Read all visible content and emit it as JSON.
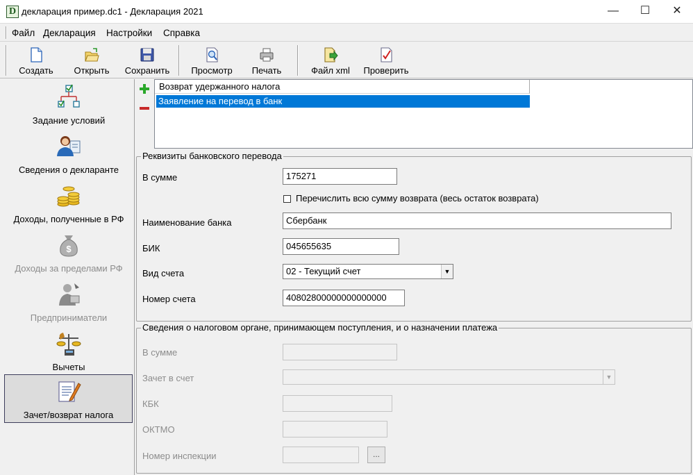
{
  "window": {
    "title": "декларация пример.dc1 - Декларация 2021",
    "app_icon_letter": "D",
    "minimize": "—",
    "maximize": "☐",
    "close": "✕"
  },
  "menu": [
    "Файл",
    "Декларация",
    "Настройки",
    "Справка"
  ],
  "toolbar": {
    "create": "Создать",
    "open": "Открыть",
    "save": "Сохранить",
    "preview": "Просмотр",
    "print": "Печать",
    "xml": "Файл xml",
    "check": "Проверить"
  },
  "sidebar": [
    {
      "label": "Задание условий",
      "icon": "flowchart-icon",
      "enabled": true
    },
    {
      "label": "Сведения о декларанте",
      "icon": "person-icon",
      "enabled": true
    },
    {
      "label": "Доходы, полученные в РФ",
      "icon": "coins-icon",
      "enabled": true
    },
    {
      "label": "Доходы за пределами РФ",
      "icon": "money-bag-icon",
      "enabled": false
    },
    {
      "label": "Предприниматели",
      "icon": "businessman-icon",
      "enabled": false
    },
    {
      "label": "Вычеты",
      "icon": "scales-icon",
      "enabled": true
    },
    {
      "label": "Зачет/возврат налога",
      "icon": "document-edit-icon",
      "enabled": true,
      "active": true
    }
  ],
  "list": {
    "header": "Возврат удержанного налога",
    "rows": [
      "Заявление на перевод в банк"
    ]
  },
  "bank_group": {
    "title": "Реквизиты банковского перевода",
    "amount_label": "В сумме",
    "amount_value": "175271",
    "transfer_all_label": "Перечислить всю сумму возврата (весь остаток возврата)",
    "transfer_all_checked": false,
    "bank_name_label": "Наименование банка",
    "bank_name_value": "Сбербанк",
    "bik_label": "БИК",
    "bik_value": "045655635",
    "account_type_label": "Вид счета",
    "account_type_value": "02 - Текущий счет",
    "account_number_label": "Номер счета",
    "account_number_value": "40802800000000000000"
  },
  "tax_group": {
    "title": "Сведения о налоговом органе, принимающем поступления, и о назначении платежа",
    "amount_label": "В сумме",
    "offset_label": "Зачет в счет",
    "kbk_label": "КБК",
    "oktmo_label": "ОКТМО",
    "inspection_label": "Номер инспекции",
    "browse_button": "..."
  }
}
